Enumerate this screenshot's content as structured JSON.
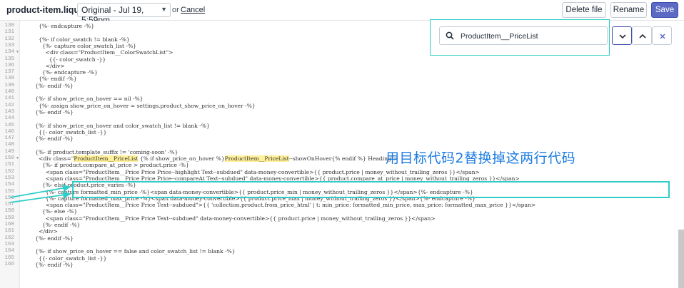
{
  "header": {
    "filename": "product-item.liquid",
    "version_selected": "Original - Jul 19, 5:59pm",
    "or_label": "or",
    "cancel_label": "Cancel",
    "delete_label": "Delete file",
    "rename_label": "Rename",
    "save_label": "Save"
  },
  "search": {
    "query": "ProductItem__PriceList"
  },
  "annotation": "用目标代码2替换掉这两行代码",
  "colors": {
    "save_button": "#5c6ac4",
    "highlight_box": "#2ecdc8",
    "annotation_text": "#1c7be0",
    "search_highlight": "#fff099"
  },
  "code_lines": [
    {
      "n": "130",
      "text": "          {%- endcapture -%}"
    },
    {
      "n": "131",
      "text": ""
    },
    {
      "n": "132",
      "text": "          {%- if color_swatch != blank -%}"
    },
    {
      "n": "133",
      "text": "            {%- capture color_swatch_list -%}"
    },
    {
      "n": "134",
      "text": "              <div class=\"ProductItem__ColorSwatchList\">"
    },
    {
      "n": "135",
      "text": "                {{- color_swatch -}}"
    },
    {
      "n": "136",
      "text": "              </div>"
    },
    {
      "n": "137",
      "text": "            {%- endcapture -%}"
    },
    {
      "n": "138",
      "text": "          {%- endif -%}"
    },
    {
      "n": "139",
      "text": "        {%- endif -%}"
    },
    {
      "n": "140",
      "text": ""
    },
    {
      "n": "141",
      "text": "        {%- if show_price_on_hover == nil -%}"
    },
    {
      "n": "142",
      "text": "          {%- assign show_price_on_hover = settings.product_show_price_on_hover -%}"
    },
    {
      "n": "143",
      "text": "        {%- endif -%}"
    },
    {
      "n": "144",
      "text": ""
    },
    {
      "n": "145",
      "text": "        {%- if show_price_on_hover and color_swatch_list != blank -%}"
    },
    {
      "n": "146",
      "text": "          {{- color_swatch_list -}}"
    },
    {
      "n": "147",
      "text": "        {%- endif -%}"
    },
    {
      "n": "148",
      "text": ""
    },
    {
      "n": "149",
      "text": "        {%- if product.template_suffix != 'coming-soon' -%}"
    },
    {
      "n": "150",
      "text": "          <div class=\"ProductItem__PriceList {% if show_price_on_hover %}ProductItem__PriceList--showOnHover{% endif %} Heading\">"
    },
    {
      "n": "151",
      "text": "            {%- if product.compare_at_price > product.price -%}"
    },
    {
      "n": "152",
      "text": "              <span class=\"ProductItem__Price Price Price--highlight Text--subdued\" data-money-convertible>{{ product.price | money_without_trailing_zeros }}</span>"
    },
    {
      "n": "153",
      "text": "              <span class=\"ProductItem__Price Price Price--compareAt Text--subdued\" data-money-convertible>{{ product.compare_at_price | money_without_trailing_zeros }}</span>"
    },
    {
      "n": "154",
      "text": "            {%- elsif product.price_varies -%}"
    },
    {
      "n": "155",
      "text": "              {%- capture formatted_min_price -%}<span data-money-convertible>{{ product.price_min | money_without_trailing_zeros }}</span>{%- endcapture -%}"
    },
    {
      "n": "156",
      "text": "              {%- capture formatted_max_price -%}<span data-money-convertible>{{ product.price_max | money_without_trailing_zeros }}</span>{%- endcapture -%}"
    },
    {
      "n": "157",
      "text": "              <span class=\"ProductItem__Price Price Text--subdued\">{{ 'collection.product.from_price_html' | t: min_price: formatted_min_price, max_price: formatted_max_price }}</span>"
    },
    {
      "n": "158",
      "text": "            {%- else -%}"
    },
    {
      "n": "159",
      "text": "              <span class=\"ProductItem__Price Price Text--subdued\" data-money-convertible>{{ product.price | money_without_trailing_zeros }}</span>"
    },
    {
      "n": "160",
      "text": "            {%- endif -%}"
    },
    {
      "n": "161",
      "text": "          </div>"
    },
    {
      "n": "162",
      "text": "        {%- endif -%}"
    },
    {
      "n": "163",
      "text": ""
    },
    {
      "n": "164",
      "text": "        {%- if show_price_on_hover == false and color_swatch_list != blank -%}"
    },
    {
      "n": "165",
      "text": "          {{- color_swatch_list -}}"
    },
    {
      "n": "166",
      "text": "        {%- endif -%}"
    }
  ]
}
